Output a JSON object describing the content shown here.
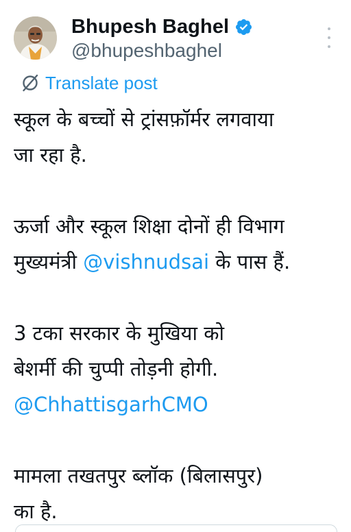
{
  "author": {
    "display_name": "Bhupesh Baghel",
    "handle": "@bhupeshbaghel",
    "verified": true
  },
  "translate": {
    "label": "Translate post",
    "icon": "translate-icon"
  },
  "post": {
    "p1": {
      "line1": "स्कूल के बच्चों से ट्रांसफ़ॉर्मर लगवाया",
      "line2": "जा रहा है."
    },
    "p2": {
      "line1": "ऊर्जा और स्कूल शिक्षा दोनों ही विभाग",
      "line2_prefix": "मुख्यमंत्री ",
      "line2_mention": "@vishnudsai",
      "line2_suffix": " के पास हैं."
    },
    "p3": {
      "line1": "3 टका सरकार के मुखिया को",
      "line2": "बेशर्मी की चुप्पी तोड़नी होगी.",
      "line3_mention": "@ChhattisgarhCMO"
    },
    "p4": {
      "line1": "मामला तखतपुर ब्लॉक (बिलासपुर)",
      "line2": "का है."
    }
  },
  "colors": {
    "link": "#1d9bf0",
    "text": "#0f1419",
    "secondary": "#536471",
    "verified": "#1d9bf0"
  }
}
